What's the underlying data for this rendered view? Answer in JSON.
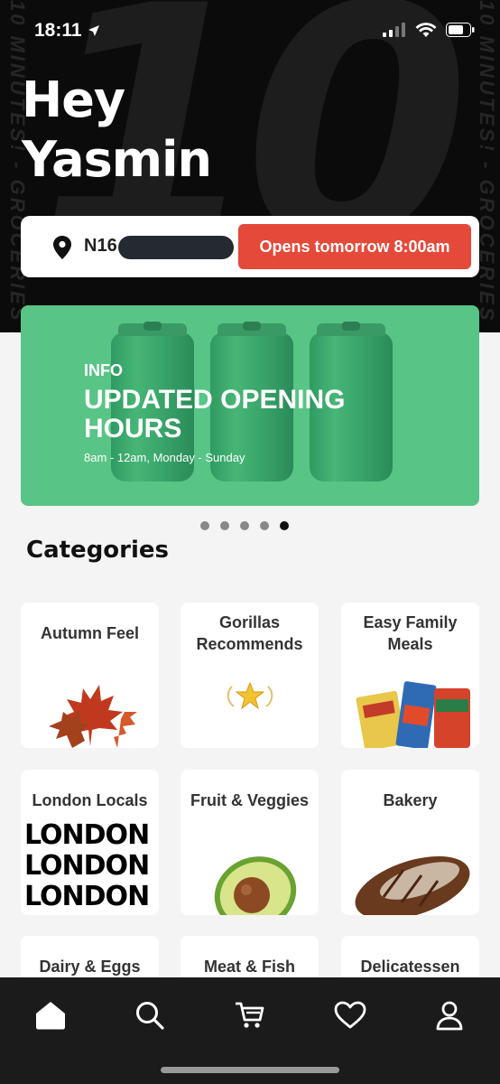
{
  "status_bar": {
    "time": "18:11"
  },
  "header": {
    "greeting_line1": "Hey",
    "greeting_line2": "Yasmin",
    "bg_text_big": "10",
    "bg_text_vertical": "10 MINUTES! - GROCERIES IN 10 MINUTES! - GROCERIES"
  },
  "location": {
    "postcode": "N16",
    "open_status_label": "Opens tomorrow 8:00am"
  },
  "banner": {
    "kicker": "INFO",
    "title": "UPDATED OPENING HOURS",
    "subtitle": "8am - 12am, Monday - Sunday",
    "page_count": 5,
    "active_page": 5
  },
  "categories": {
    "heading": "Categories",
    "items": [
      {
        "label": "Autumn Feel"
      },
      {
        "label": "Gorillas Recommends"
      },
      {
        "label": "Easy Family Meals"
      },
      {
        "label": "London Locals",
        "art_text": "LONDON"
      },
      {
        "label": "Fruit & Veggies"
      },
      {
        "label": "Bakery"
      },
      {
        "label": "Dairy & Eggs"
      },
      {
        "label": "Meat & Fish"
      },
      {
        "label": "Delicatessen"
      }
    ]
  },
  "tabbar": {
    "items": [
      {
        "icon": "home-icon",
        "active": true
      },
      {
        "icon": "search-icon"
      },
      {
        "icon": "cart-icon"
      },
      {
        "icon": "heart-icon"
      },
      {
        "icon": "profile-icon"
      }
    ]
  },
  "colors": {
    "accent_red": "#e5493a",
    "banner_green": "#58c485",
    "hero_bg": "#0b0b0b"
  }
}
